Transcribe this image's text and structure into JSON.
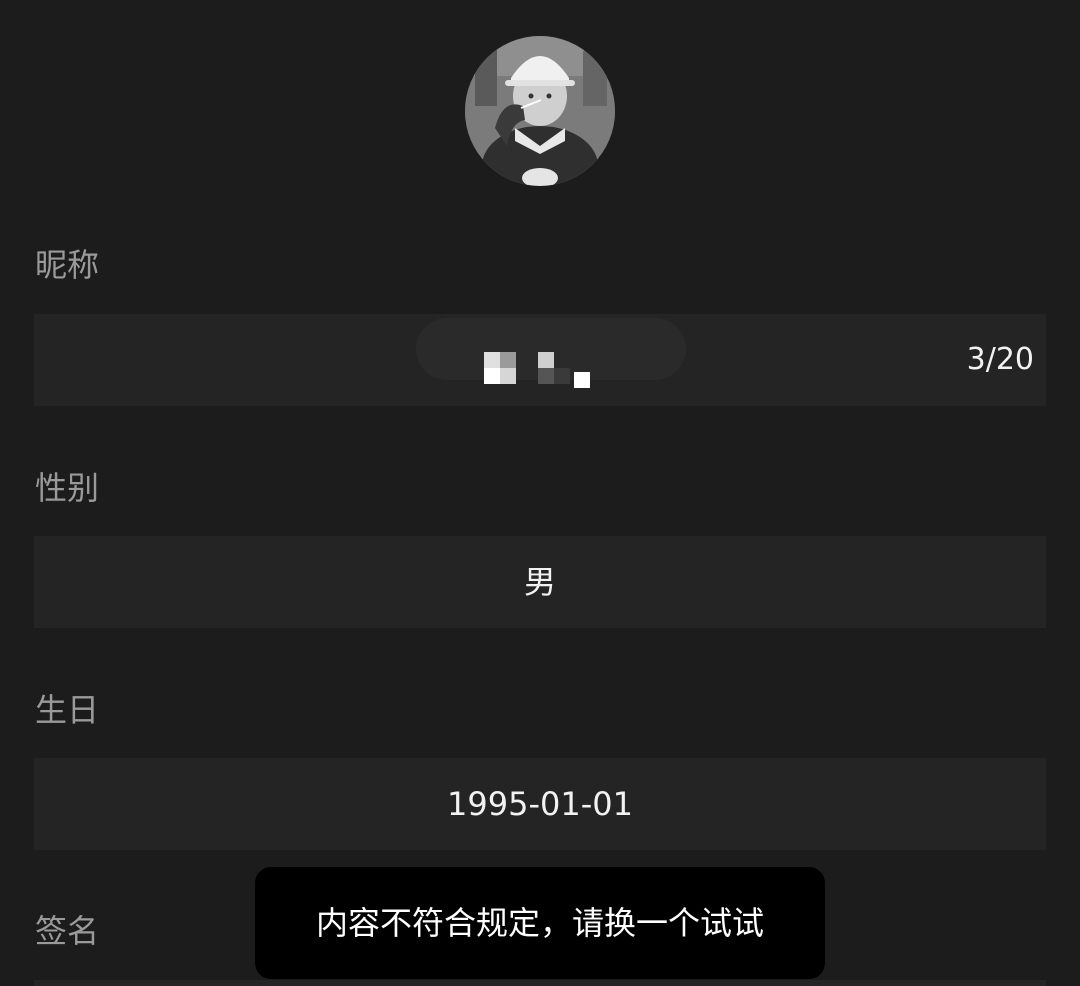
{
  "profile": {
    "avatar_icon": "avatar-photo"
  },
  "fields": {
    "nickname": {
      "label": "昵称",
      "counter": "3/20"
    },
    "gender": {
      "label": "性别",
      "value": "男"
    },
    "birthday": {
      "label": "生日",
      "value": "1995-01-01"
    },
    "signature": {
      "label": "签名"
    }
  },
  "toast": {
    "message": "内容不符合规定，请换一个试试"
  }
}
